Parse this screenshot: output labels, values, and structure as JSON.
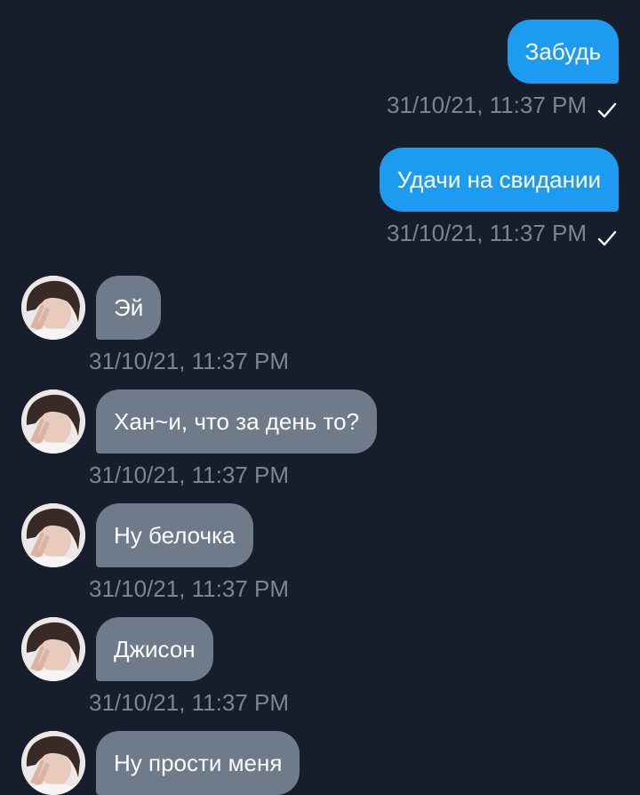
{
  "messages": [
    {
      "direction": "outgoing",
      "text": "Забудь",
      "timestamp": "31/10/21, 11:37 PM",
      "status_icon": "check-icon"
    },
    {
      "direction": "outgoing",
      "text": "Удачи на свидании",
      "timestamp": "31/10/21, 11:37 PM",
      "status_icon": "check-icon"
    },
    {
      "direction": "incoming",
      "text": "Эй",
      "timestamp": "31/10/21, 11:37 PM",
      "avatar": "avatar"
    },
    {
      "direction": "incoming",
      "text": "Хан~и, что за день то?",
      "timestamp": "31/10/21, 11:37 PM",
      "avatar": "avatar"
    },
    {
      "direction": "incoming",
      "text": "Ну белочка",
      "timestamp": "31/10/21, 11:37 PM",
      "avatar": "avatar"
    },
    {
      "direction": "incoming",
      "text": "Джисон",
      "timestamp": "31/10/21, 11:37 PM",
      "avatar": "avatar"
    },
    {
      "direction": "incoming",
      "text": "Ну прости меня",
      "timestamp": "",
      "avatar": "avatar"
    }
  ],
  "colors": {
    "background": "#161d2b",
    "outgoing_bubble": "#1d9bf0",
    "incoming_bubble": "#6f7a8b",
    "meta_text": "#7c8594"
  }
}
